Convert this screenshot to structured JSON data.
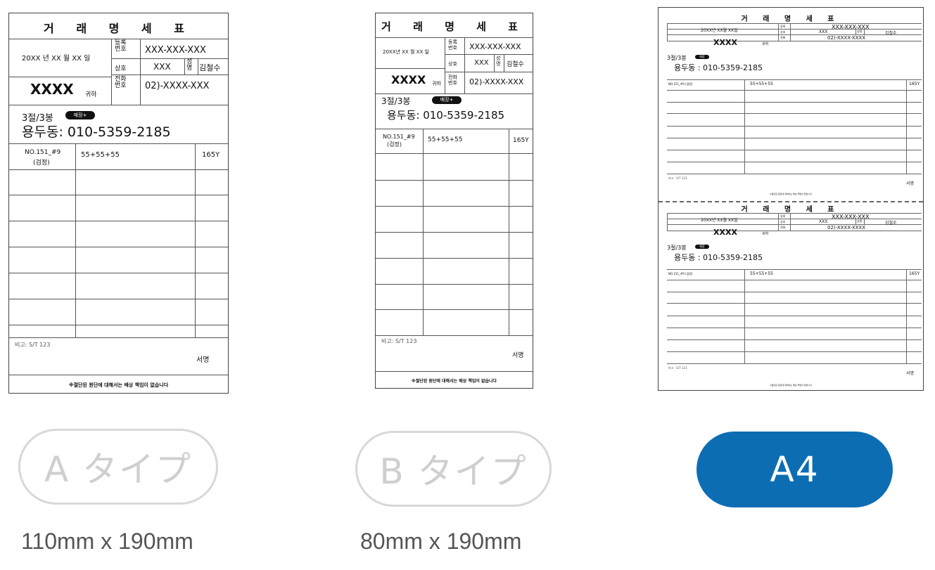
{
  "receipt": {
    "title": "거 래 명 세 표",
    "date": "20XX 년 XX 월 XX 일",
    "date_b": "20XX년 XX 월 XX 일",
    "reg_label": "등록\n번호",
    "reg_value": "XXX-XXX-XXX",
    "company_label": "상호",
    "company_value": "XXX",
    "name_label": "성\n명",
    "name_value": "김철수",
    "customer": "XXXX",
    "honorific": "귀하",
    "phone_label": "전화\n번호",
    "phone_value": "02)-XXXX-XXX",
    "qty": "3절/3봉",
    "badge": "매장+",
    "store_phone": "용두동: 010-5359-2185",
    "item_no": "NO.151_#9",
    "item_color": "(검정)",
    "item_calc": "55+55+55",
    "item_total": "165Y",
    "note": "비고:   S/T 123",
    "signature": "서명",
    "disclaimer": "※절단된 원단에 대해서는 배상 책임이 없습니다"
  },
  "a4_sheet": {
    "title": "거 래 명 세 표",
    "date": "20XX년 XX월 XX일",
    "reg_label": "등록",
    "reg_value": "XXX-XXX-XXX",
    "company_label": "상호",
    "company_value": "XXX",
    "name_label": "성명",
    "name_value": "김철수",
    "customer": "XXXX",
    "honorific": "귀하",
    "phone_label": "전화",
    "phone_value": "02)-XXXX-XXXX",
    "qty": "3절/3봉",
    "badge": "매장",
    "store_phone": "용두동 : 010-5359-2185",
    "item_no": "NO.151_#9 (검정)",
    "item_calc": "55+55+55",
    "item_total": "165Y",
    "note": "비고 : S/T 123",
    "signature": "서명",
    "disclaimer": "※절단된 원단에 대해서는 배상 책임이 없습니다"
  },
  "types": [
    {
      "label": "A タイプ",
      "dimensions": "110mm x 190mm",
      "selected": false
    },
    {
      "label": "B タイプ",
      "dimensions": "80mm x 190mm",
      "selected": false
    },
    {
      "label": "A4",
      "dimensions": "",
      "selected": true
    }
  ],
  "colors": {
    "active": "#0d6db3",
    "inactive_border": "#d8d8d8",
    "inactive_text": "#cfcfcf"
  }
}
